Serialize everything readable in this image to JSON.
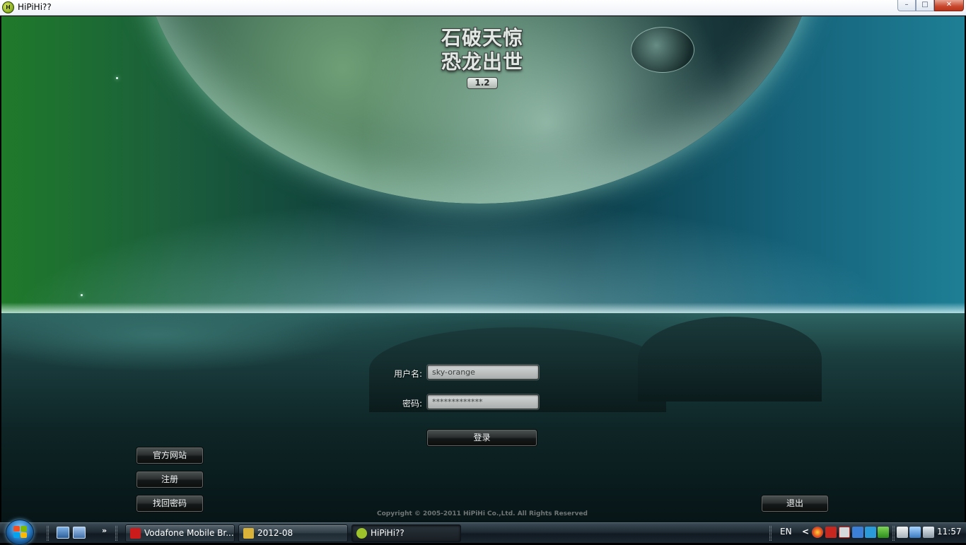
{
  "window": {
    "title": "HiPiHi??",
    "app_icon_text": "H",
    "controls": {
      "minimize": "–",
      "maximize": "□",
      "close": "✕"
    }
  },
  "game": {
    "logo_line1": "石破天惊",
    "logo_line2": "恐龙出世",
    "version": "1.2",
    "login": {
      "username_label": "用户名:",
      "username_value": "sky-orange",
      "password_label": "密码:",
      "password_value": "*************",
      "login_button": "登录"
    },
    "side_buttons": {
      "official_site": "官方网站",
      "register": "注册",
      "recover_password": "找回密码"
    },
    "exit_button": "退出",
    "copyright": "Copyright © 2005-2011 HiPiHi Co.,Ltd. All Rights Reserved"
  },
  "taskbar": {
    "overflow_chevron": "»",
    "tasks": [
      {
        "label": "Vodafone Mobile Br...",
        "icon": "vodafone-icon",
        "icon_color": "#cc1b1b"
      },
      {
        "label": "2012-08",
        "icon": "folder-icon",
        "icon_color": "#d9b23a"
      },
      {
        "label": "HiPiHi??",
        "icon": "hipihi-icon",
        "icon_color": "#9fc32a"
      }
    ],
    "language": "EN",
    "tray_chevron": "<",
    "clock": "11:57"
  },
  "colors": {
    "titlebar_bg": "#eef2f8",
    "close_button": "#c8462c",
    "taskbar_bg": "#1f2a33",
    "field_bg": "#c2c6c5",
    "button_bg": "#1e2222"
  }
}
